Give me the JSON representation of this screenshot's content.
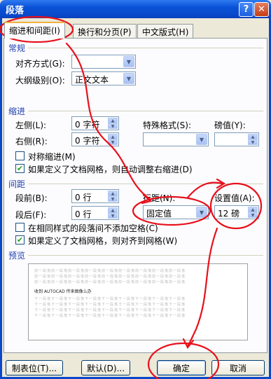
{
  "window": {
    "title": "段落",
    "help": "?",
    "close": "✕"
  },
  "tabs": [
    "缩进和间距(I)",
    "换行和分页(P)",
    "中文版式(H)"
  ],
  "general": {
    "section": "常规",
    "alignment_label": "对齐方式(G):",
    "alignment_value": "",
    "outline_label": "大纲级别(O):",
    "outline_value": "正文文本"
  },
  "indent": {
    "section": "缩进",
    "left_label": "左侧(L):",
    "left_value": "0 字符",
    "right_label": "右侧(R):",
    "right_value": "0 字符",
    "special_label": "特殊格式(S):",
    "special_value": "",
    "by_label": "磅值(Y):",
    "by_value": "",
    "mirror_label": "对称缩进(M)",
    "mirror_checked": false,
    "auto_adjust_label": "如果定义了文档网格，则自动调整右缩进(D)",
    "auto_adjust_checked": true
  },
  "spacing": {
    "section": "间距",
    "before_label": "段前(B):",
    "before_value": "0 行",
    "after_label": "段后(F):",
    "after_value": "0 行",
    "line_label": "行距(N):",
    "line_value": "固定值",
    "at_label": "设置值(A):",
    "at_value": "12 磅",
    "no_space_label": "在相同样式的段落间不添加空格(C)",
    "no_space_checked": false,
    "snap_grid_label": "如果定义了文档网格，则对齐到网格(W)",
    "snap_grid_checked": true
  },
  "preview": {
    "section": "预览",
    "filler": "前一段落前一段落前一段落前一段落前一段落前一段落前一段落前一段落前一段落",
    "sample": "收到 AUTOCAD 传来图像么办",
    "after_filler": "下一段落下一段落下一段落下一段落下一段落下一段落下一段落下一段落下一段落"
  },
  "buttons": {
    "tabs": "制表位(T)...",
    "default": "默认(D)...",
    "ok": "确定",
    "cancel": "取消"
  }
}
